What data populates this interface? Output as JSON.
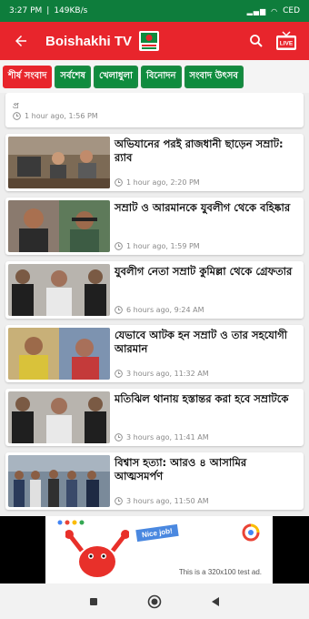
{
  "status_bar": {
    "time": "3:27 PM",
    "speed": "149KB/s",
    "battery": "CED"
  },
  "app_bar": {
    "title": "Boishakhi TV",
    "accent": "#e8252c"
  },
  "tabs": [
    {
      "label": "শীর্ষ সংবাদ",
      "active": true
    },
    {
      "label": "সর্বশেষ",
      "active": false
    },
    {
      "label": "খেলাধুলা",
      "active": false
    },
    {
      "label": "বিনোদন",
      "active": false
    },
    {
      "label": "সংবাদ উৎসব",
      "active": false
    }
  ],
  "partial_card": {
    "title": "প্র",
    "time": "1 hour ago, 1:56 PM"
  },
  "news": [
    {
      "title": "অভিযানের পরই রাজধানী ছাড়েন সম্রাট: র‍্যাব",
      "time": "1 hour ago, 2:20 PM"
    },
    {
      "title": "সম্রাট ও আরমানকে যুবলীগ থেকে বহিষ্কার",
      "time": "1 hour ago, 1:59 PM"
    },
    {
      "title": "যুবলীগ নেতা সম্রাট কুমিল্লা থেকে গ্রেফতার",
      "time": "6 hours ago, 9:24 AM"
    },
    {
      "title": "যেভাবে আটক হন সম্রাট ও তার সহযোগী আরমান",
      "time": "3 hours ago, 11:32 AM"
    },
    {
      "title": "মতিঝিল থানায় হস্তান্তর করা হবে সম্রাটকে",
      "time": "3 hours ago, 11:41 AM"
    },
    {
      "title": "বিশ্বাস হত্যা: আরও ৪ আসামির আত্মসমর্পণ",
      "time": "3 hours ago, 11:50 AM"
    }
  ],
  "ad": {
    "badge": "Nice job!",
    "text": "This is a 320x100 test ad."
  },
  "colors": {
    "status_green": "#0e7d3c",
    "tab_green": "#0f8c3e",
    "red": "#e8252c"
  }
}
